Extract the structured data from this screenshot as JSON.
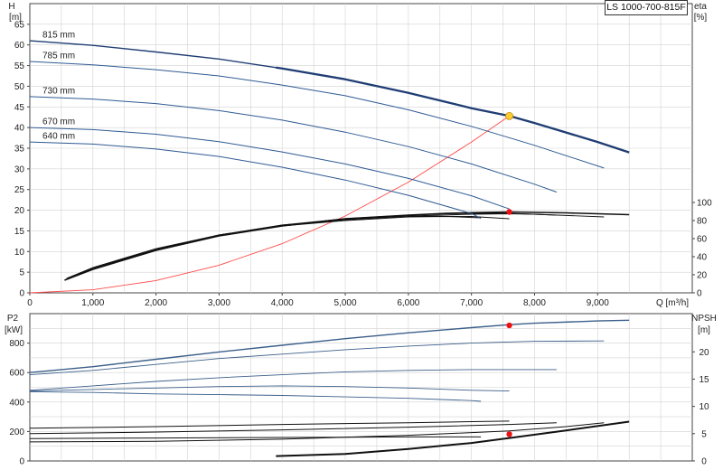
{
  "title": "LS 1000-700-815F",
  "chart_data": [
    {
      "type": "line",
      "x_label": "Q [m³/h]",
      "xlim": [
        0,
        10500
      ],
      "x_ticks": [
        {
          "v": 0,
          "label": "0"
        },
        {
          "v": 1000,
          "label": "1,000"
        },
        {
          "v": 2000,
          "label": "2,000"
        },
        {
          "v": 3000,
          "label": "3,000"
        },
        {
          "v": 4000,
          "label": "4,000"
        },
        {
          "v": 5000,
          "label": "5,000"
        },
        {
          "v": 6000,
          "label": "6,000"
        },
        {
          "v": 7000,
          "label": "7,000"
        },
        {
          "v": 8000,
          "label": "8,000"
        },
        {
          "v": 9000,
          "label": "9,000"
        }
      ],
      "y_left_label": [
        "H",
        "[m]"
      ],
      "ylim_left": [
        0,
        70
      ],
      "y_left_ticks": [
        0,
        5,
        10,
        15,
        20,
        25,
        30,
        35,
        40,
        45,
        50,
        55,
        60,
        65
      ],
      "y_right_label": [
        "eta",
        "[%]"
      ],
      "ylim_right": [
        0,
        320
      ],
      "y_right_ticks": [
        0,
        20,
        40,
        60,
        80,
        100
      ],
      "grid": true,
      "head_curves": [
        {
          "name": "815 mm",
          "emphasis": true,
          "x": [
            0,
            1000,
            2000,
            3000,
            4000,
            5000,
            6000,
            7000,
            7600,
            8000,
            9000,
            9500
          ],
          "y": [
            61,
            59.9,
            58.3,
            56.6,
            54.3,
            51.7,
            48.4,
            44.7,
            42.8,
            41.1,
            36.5,
            34.0
          ]
        },
        {
          "name": "785 mm",
          "x": [
            0,
            1000,
            2000,
            3000,
            4000,
            5000,
            6000,
            7000,
            8000,
            9100
          ],
          "y": [
            56,
            55.2,
            54.0,
            52.5,
            50.3,
            47.7,
            44.3,
            40.3,
            35.7,
            30.2
          ]
        },
        {
          "name": "730 mm",
          "x": [
            0,
            1000,
            2000,
            3000,
            4000,
            5000,
            6000,
            7000,
            8000,
            8350
          ],
          "y": [
            47.5,
            46.9,
            45.8,
            44.1,
            41.8,
            38.9,
            35.4,
            31.2,
            26.3,
            24.4
          ]
        },
        {
          "name": "670 mm",
          "x": [
            0,
            1000,
            2000,
            3000,
            4000,
            5000,
            6000,
            7000,
            7600
          ],
          "y": [
            40,
            39.5,
            38.4,
            36.6,
            34.1,
            31.2,
            27.7,
            23.5,
            20.3
          ]
        },
        {
          "name": "640 mm",
          "x": [
            0,
            1000,
            2000,
            3000,
            4000,
            5000,
            6000,
            7000,
            7150
          ],
          "y": [
            36.5,
            36.0,
            34.8,
            33.0,
            30.4,
            27.3,
            23.6,
            19.2,
            18.0
          ]
        }
      ],
      "system_curve": {
        "x": [
          0,
          1000,
          2000,
          3000,
          4000,
          5000,
          6000,
          7000,
          7600
        ],
        "y": [
          0,
          0.74,
          2.98,
          6.7,
          11.9,
          18.6,
          26.8,
          36.5,
          42.8
        ]
      },
      "eta_curves": [
        {
          "x": [
            550,
            1000,
            2000,
            3000,
            4000,
            5000,
            6000,
            6600,
            7200,
            7600,
            8500,
            9500
          ],
          "y": [
            14,
            26,
            47,
            63,
            74,
            82,
            86,
            88,
            89,
            89.5,
            88.5,
            86.5
          ]
        },
        {
          "x": [
            580,
            1000,
            2000,
            3000,
            4000,
            5000,
            6000,
            6600,
            7200,
            7600,
            8350
          ],
          "y": [
            16,
            28,
            48,
            64,
            75,
            82,
            86,
            87.5,
            88,
            88,
            86
          ]
        },
        {
          "x": [
            600,
            1000,
            2000,
            3000,
            4000,
            5000,
            6000,
            7000,
            7600,
            8000,
            9100
          ],
          "y": [
            16,
            27,
            48,
            64,
            75,
            81,
            85,
            87,
            87.5,
            87,
            84
          ]
        },
        {
          "x": [
            620,
            1000,
            2000,
            3000,
            4000,
            5000,
            6000,
            7000,
            7600
          ],
          "y": [
            17,
            27,
            48,
            64,
            74,
            81,
            85,
            84.5,
            82
          ]
        },
        {
          "x": [
            650,
            1000,
            2000,
            3000,
            4000,
            5000,
            6000,
            6600,
            7150
          ],
          "y": [
            17,
            28,
            49,
            64,
            74,
            80,
            84,
            84.5,
            83
          ]
        }
      ],
      "operating_point": {
        "x": 7600,
        "head": 42.8,
        "eta": 89.5
      }
    },
    {
      "type": "line",
      "xlim": [
        0,
        10500
      ],
      "y_left_label": [
        "P2",
        "[kW]"
      ],
      "ylim_left": [
        0,
        1000
      ],
      "y_left_ticks": [
        0,
        200,
        400,
        600,
        800
      ],
      "y_right_label": [
        "NPSH",
        "[m]"
      ],
      "ylim_right": [
        0,
        27
      ],
      "y_right_ticks": [
        0,
        5,
        10,
        15,
        20
      ],
      "grid": true,
      "power_curves": [
        {
          "x": [
            0,
            1000,
            2000,
            3000,
            4000,
            5000,
            6000,
            7000,
            7600,
            8000,
            9000,
            9500
          ],
          "y": [
            600,
            640,
            690,
            740,
            785,
            830,
            870,
            905,
            925,
            935,
            950,
            955
          ]
        },
        {
          "x": [
            0,
            1000,
            2000,
            3000,
            4000,
            5000,
            6000,
            7000,
            8000,
            9100
          ],
          "y": [
            585,
            615,
            655,
            695,
            725,
            755,
            780,
            800,
            812,
            815
          ]
        },
        {
          "x": [
            0,
            1000,
            2000,
            3000,
            4000,
            5000,
            6000,
            7000,
            8000,
            8350
          ],
          "y": [
            480,
            510,
            540,
            565,
            585,
            605,
            615,
            620,
            620,
            620
          ]
        },
        {
          "x": [
            0,
            1000,
            2000,
            3000,
            4000,
            5000,
            6000,
            7000,
            7600
          ],
          "y": [
            475,
            485,
            495,
            505,
            510,
            505,
            495,
            480,
            475
          ]
        },
        {
          "x": [
            0,
            1000,
            2000,
            3000,
            4000,
            5000,
            6000,
            7000,
            7150
          ],
          "y": [
            470,
            465,
            455,
            450,
            445,
            435,
            425,
            410,
            405
          ]
        }
      ],
      "npsh_curves": [
        {
          "x": [
            3900,
            5000,
            6000,
            7000,
            7600,
            8500,
            9500
          ],
          "y": [
            0.9,
            1.3,
            2.2,
            3.3,
            4.2,
            5.6,
            7.2
          ]
        },
        {
          "x": [
            0,
            2000,
            4000,
            6000,
            7600,
            8500,
            9100
          ],
          "y": [
            3.5,
            3.6,
            4.0,
            4.7,
            5.5,
            6.3,
            7.0
          ]
        },
        {
          "x": [
            0,
            2000,
            4000,
            6000,
            7600,
            8350
          ],
          "y": [
            5.0,
            5.3,
            5.7,
            6.2,
            6.7,
            7.0
          ]
        },
        {
          "x": [
            0,
            2000,
            4000,
            6000,
            7000,
            7600
          ],
          "y": [
            6.0,
            6.3,
            6.7,
            7.0,
            7.2,
            7.3
          ]
        },
        {
          "x": [
            0,
            2000,
            4000,
            6000,
            7150
          ],
          "y": [
            4.1,
            4.2,
            4.3,
            4.4,
            4.4
          ]
        }
      ],
      "operating_point": {
        "x": 7600,
        "power": 920,
        "npsh": 4.9
      }
    }
  ],
  "colors": {
    "head": "#1f3d73",
    "head_light": "#2f5a93",
    "system": "#ff4a4a",
    "eta": "#111111",
    "grid": "#d2d2d2",
    "op_main": "#ffcc33",
    "op_secondary": "#ee1111",
    "power": "#3b5f8a",
    "npsh": "#111111"
  }
}
